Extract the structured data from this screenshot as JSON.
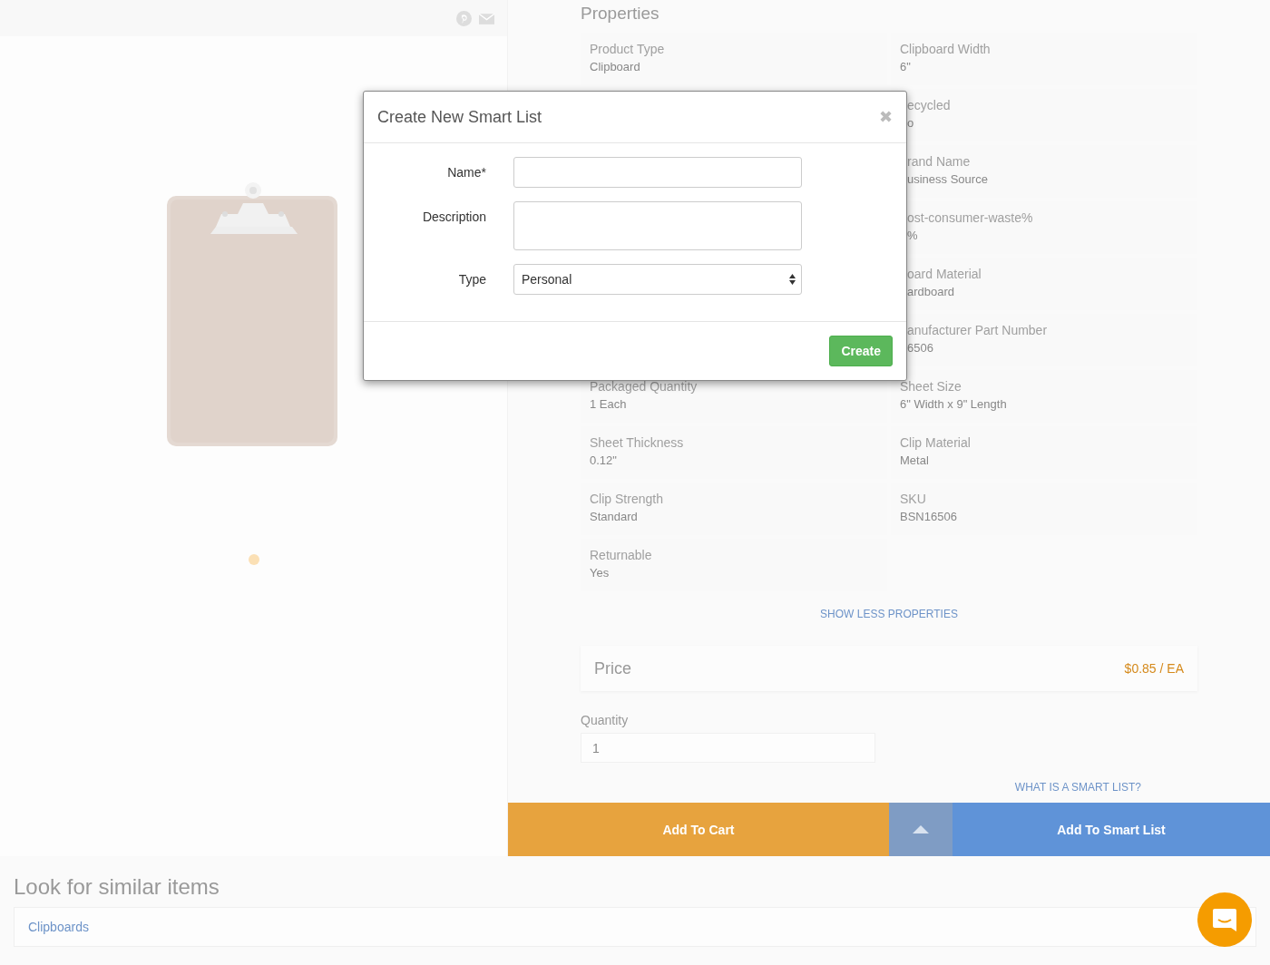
{
  "properties": {
    "title": "Properties",
    "rows": [
      {
        "left": {
          "label": "Product Type",
          "value": "Clipboard"
        },
        "right": {
          "label": "Clipboard Width",
          "value": "6\""
        }
      },
      {
        "right": {
          "label": "ecycled",
          "value": "o"
        }
      },
      {
        "right": {
          "label": "rand Name",
          "value": "usiness Source"
        }
      },
      {
        "right": {
          "label": "ost-consumer-waste%",
          "value": "%"
        }
      },
      {
        "right": {
          "label": "oard Material",
          "value": "ardboard"
        }
      },
      {
        "right": {
          "label": "anufacturer Part Number",
          "value": "6506"
        }
      },
      {
        "left": {
          "label": "Packaged Quantity",
          "value": "1 Each"
        },
        "right": {
          "label": "Sheet Size",
          "value": "6\" Width x 9\" Length"
        }
      },
      {
        "left": {
          "label": "Sheet Thickness",
          "value": "0.12\""
        },
        "right": {
          "label": "Clip Material",
          "value": "Metal"
        }
      },
      {
        "left": {
          "label": "Clip Strength",
          "value": "Standard"
        },
        "right": {
          "label": "SKU",
          "value": "BSN16506"
        }
      },
      {
        "left": {
          "label": "Returnable",
          "value": "Yes"
        }
      }
    ],
    "toggle": "SHOW LESS PROPERTIES"
  },
  "price": {
    "label": "Price",
    "value": "$0.85 / EA"
  },
  "quantity": {
    "label": "Quantity",
    "value": "1"
  },
  "smart_list_help": "WHAT IS A SMART LIST?",
  "actions": {
    "add_to_cart": "Add To Cart",
    "add_to_smart_list": "Add To Smart List"
  },
  "carousel": [
    {
      "selected": true
    }
  ],
  "similar": {
    "title": "Look for similar items",
    "value": "Clipboards"
  },
  "modal": {
    "title": "Create New Smart List",
    "close": "✖",
    "fields": [
      {
        "kind": "text",
        "label": "Name*"
      },
      {
        "kind": "textarea",
        "label": "Description"
      },
      {
        "kind": "select",
        "label": "Type",
        "value": "Personal"
      }
    ],
    "submit": "Create"
  }
}
